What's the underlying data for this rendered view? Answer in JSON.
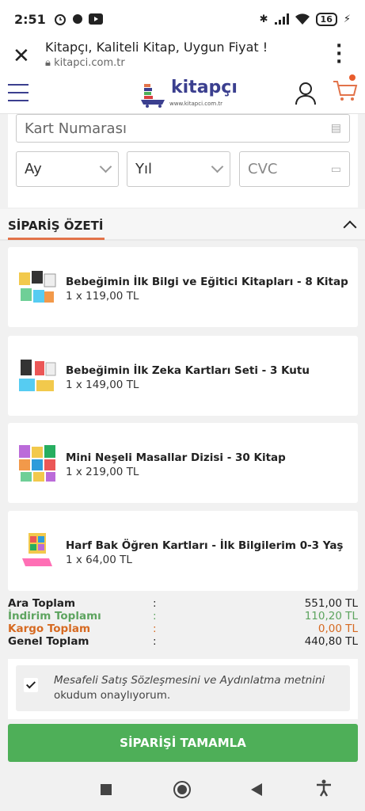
{
  "status_bar": {
    "time": "2:51",
    "battery": "16"
  },
  "browser": {
    "page_title": "Kitapçı, Kaliteli Kitap, Uygun Fiyat !",
    "domain": "kitapci.com.tr"
  },
  "header": {
    "logo_text": "kitapçı",
    "logo_sub": "www.kitapci.com.tr"
  },
  "payment_form": {
    "card_number_placeholder": "Kart Numarası",
    "month_label": "Ay",
    "year_label": "Yıl",
    "cvc_placeholder": "CVC"
  },
  "summary": {
    "title": "SİPARİŞ ÖZETİ",
    "items": [
      {
        "name": "Bebeğimin İlk Bilgi ve Eğitici Kitapları - 8 Kitap",
        "qty": "1 x 119,00 TL"
      },
      {
        "name": "Bebeğimin İlk Zeka Kartları Seti - 3 Kutu",
        "qty": "1 x 149,00 TL"
      },
      {
        "name": "Mini Neşeli Masallar Dizisi - 30 Kitap",
        "qty": "1 x 219,00 TL"
      },
      {
        "name": "Harf Bak Öğren Kartları - İlk Bilgilerim 0-3 Yaş",
        "qty": "1 x 64,00 TL"
      }
    ]
  },
  "totals": {
    "subtotal_label": "Ara Toplam",
    "subtotal_value": "551,00 TL",
    "discount_label": "İndirim Toplamı",
    "discount_value": "110,20 TL",
    "shipping_label": "Kargo Toplam",
    "shipping_value": "0,00 TL",
    "grand_label": "Genel Toplam",
    "grand_value": "440,80 TL",
    "separator": ":"
  },
  "agreement": {
    "text_italic": "Mesafeli Satış Sözleşmesini ve Aydınlatma metnini",
    "text_rest": "okudum onaylıyorum."
  },
  "actions": {
    "complete_label": "SİPARİŞİ TAMAMLA"
  },
  "colors": {
    "brand": "#3b3f8f",
    "accent": "#e2734a",
    "button": "#4eaf58",
    "discount": "#5da45f",
    "shipping": "#d66a22"
  }
}
